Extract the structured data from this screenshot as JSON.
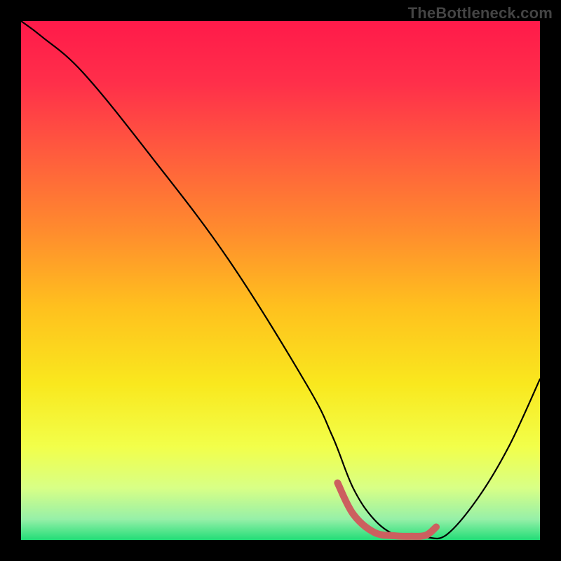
{
  "watermark": "TheBottleneck.com",
  "gradient": {
    "stops": [
      {
        "offset": 0.0,
        "color": "#ff1a4a"
      },
      {
        "offset": 0.12,
        "color": "#ff2f4a"
      },
      {
        "offset": 0.25,
        "color": "#ff5a3e"
      },
      {
        "offset": 0.4,
        "color": "#ff8a2e"
      },
      {
        "offset": 0.55,
        "color": "#ffc01e"
      },
      {
        "offset": 0.7,
        "color": "#f9e81e"
      },
      {
        "offset": 0.82,
        "color": "#f2ff4a"
      },
      {
        "offset": 0.9,
        "color": "#d8ff86"
      },
      {
        "offset": 0.96,
        "color": "#96f0a8"
      },
      {
        "offset": 1.0,
        "color": "#22dd77"
      }
    ]
  },
  "chart_data": {
    "type": "line",
    "title": "",
    "xlabel": "",
    "ylabel": "",
    "xlim": [
      0,
      100
    ],
    "ylim": [
      0,
      100
    ],
    "series": [
      {
        "name": "curve",
        "x": [
          0,
          4,
          12,
          25,
          40,
          55,
          60,
          64,
          68,
          72,
          75,
          78,
          82,
          88,
          94,
          100
        ],
        "values": [
          100,
          97,
          90,
          74,
          54,
          30,
          20,
          10,
          4,
          1,
          0.5,
          0.5,
          1,
          8,
          18,
          31
        ]
      }
    ],
    "highlight": {
      "name": "bottom-plateau",
      "color": "#cc5f5f",
      "x": [
        61,
        64,
        68,
        72,
        75,
        78,
        80
      ],
      "values": [
        11,
        5,
        1.5,
        0.8,
        0.7,
        0.9,
        2.5
      ]
    }
  }
}
